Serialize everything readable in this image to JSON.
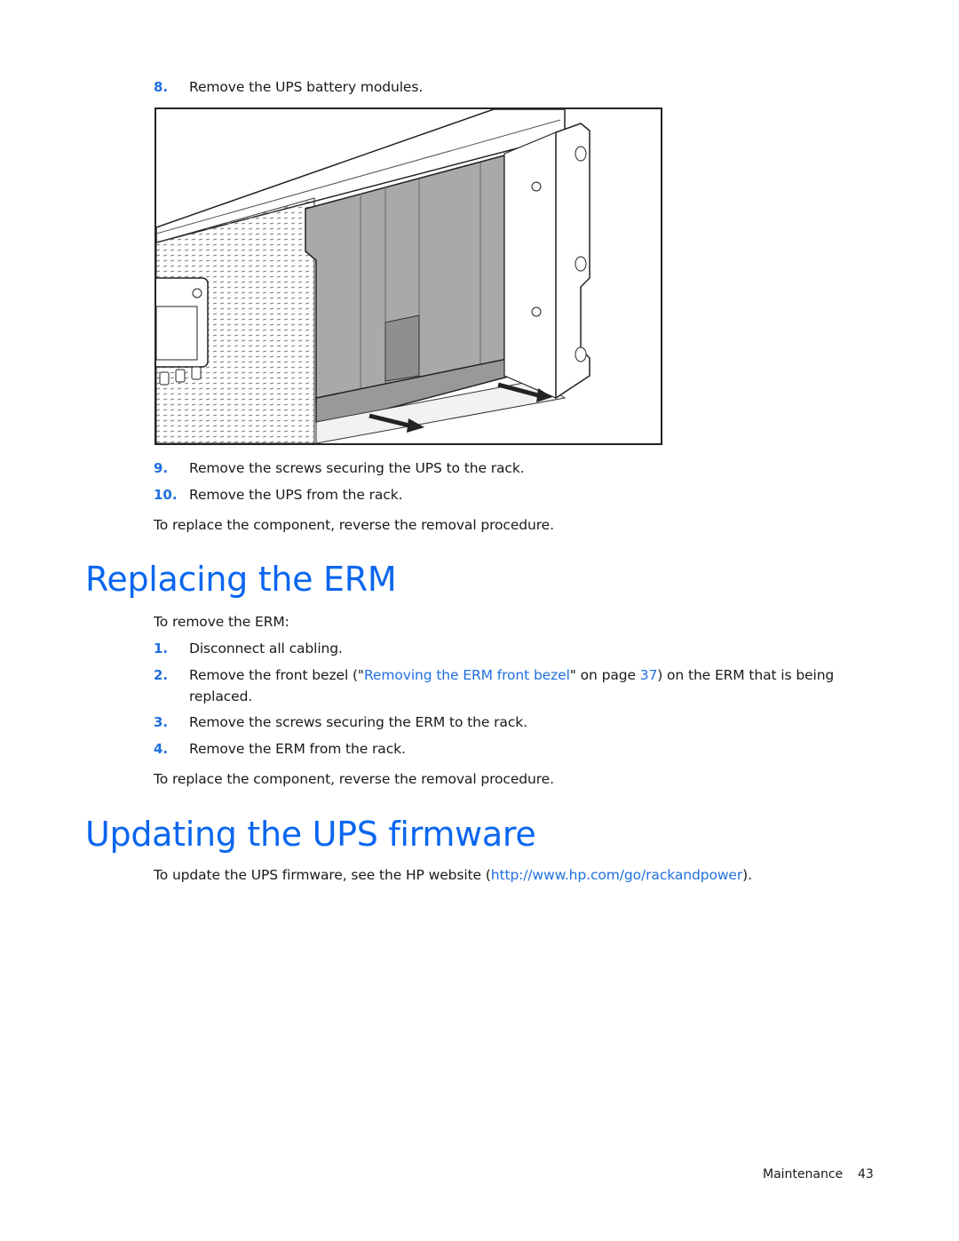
{
  "steps_top": [
    {
      "number": "8.",
      "text": "Remove the UPS battery modules."
    },
    {
      "number": "9.",
      "text": "Remove the screws securing the UPS to the rack."
    },
    {
      "number": "10.",
      "text": "Remove the UPS from the rack."
    }
  ],
  "replace_note_1": "To replace the component, reverse the removal procedure.",
  "figure": {
    "icon": "ups-battery-removal-illustration"
  },
  "section_erm": {
    "title": "Replacing the ERM",
    "intro": "To remove the ERM:",
    "steps": [
      {
        "number": "1.",
        "text": "Disconnect all cabling."
      },
      {
        "number": "2.",
        "text_before": "Remove the front bezel (\"",
        "link_text": "Removing the ERM front bezel",
        "text_mid": "\" on page ",
        "page_link": "37",
        "text_after": ") on the ERM that is being",
        "text_line2": "replaced."
      },
      {
        "number": "3.",
        "text": "Remove the screws securing the ERM to the rack."
      },
      {
        "number": "4.",
        "text": "Remove the ERM from the rack."
      }
    ],
    "replace_note": "To replace the component, reverse the removal procedure."
  },
  "section_firmware": {
    "title": "Updating the UPS firmware",
    "text_before": "To update the UPS firmware, see the HP website (",
    "link_text": "http://www.hp.com/go/rackandpower",
    "text_after": ")."
  },
  "footer": {
    "section": "Maintenance",
    "page": "43"
  },
  "colors": {
    "link": "#1f6fe0",
    "heading": "#0a66f0",
    "text": "#1a1a1a"
  }
}
